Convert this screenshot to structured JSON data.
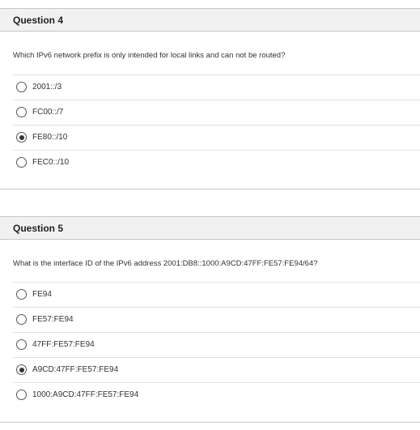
{
  "questions": [
    {
      "title": "Question 4",
      "text": "Which IPv6 network prefix is only intended for local links and can not be routed?",
      "options": [
        {
          "label": "2001::/3",
          "checked": false
        },
        {
          "label": "FC00::/7",
          "checked": false
        },
        {
          "label": "FE80::/10",
          "checked": true
        },
        {
          "label": "FEC0::/10",
          "checked": false
        }
      ]
    },
    {
      "title": "Question 5",
      "text": "What is the interface ID of the IPv6 address 2001:DB8::1000:A9CD:47FF:FE57:FE94/64?",
      "options": [
        {
          "label": "FE94",
          "checked": false
        },
        {
          "label": "FE57:FE94",
          "checked": false
        },
        {
          "label": "47FF:FE57:FE94",
          "checked": false
        },
        {
          "label": "A9CD:47FF:FE57:FE94",
          "checked": true
        },
        {
          "label": "1000:A9CD:47FF:FE57:FE94",
          "checked": false
        }
      ]
    }
  ]
}
